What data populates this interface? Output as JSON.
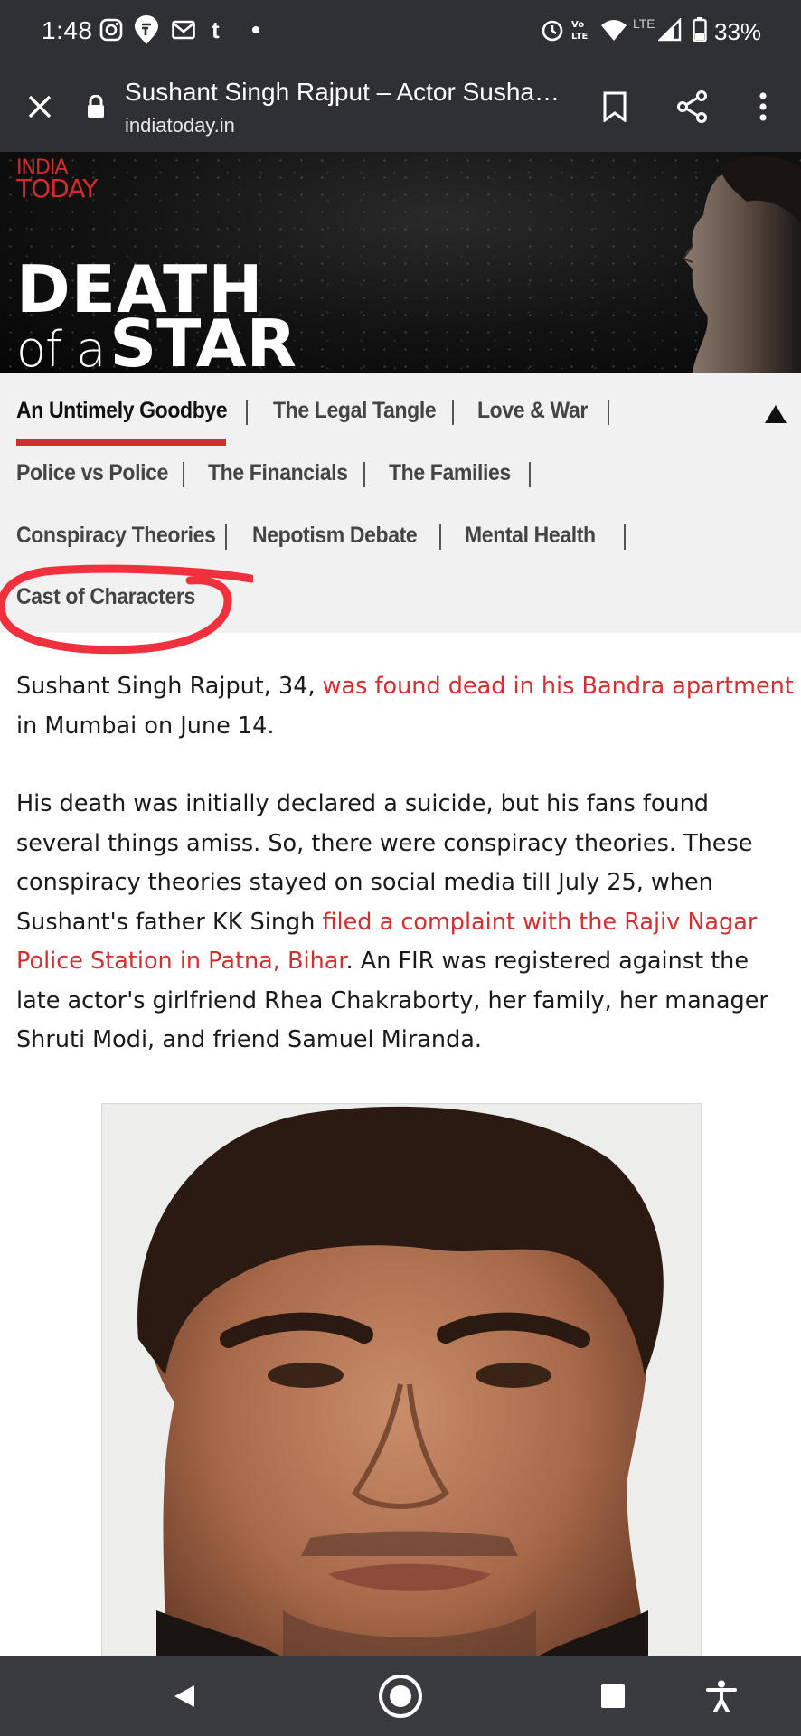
{
  "status_bar": {
    "time": "1:48",
    "battery": "33%",
    "network": "LTE",
    "left_icons": [
      "instagram-icon",
      "swiggy-icon",
      "gmail-icon",
      "tumblr-icon",
      "dot-icon"
    ],
    "right_icons": [
      "alarm-icon",
      "volte-icon",
      "wifi-icon",
      "signal-icon",
      "battery-icon"
    ]
  },
  "browser": {
    "title": "Sushant Singh Rajput – Actor Sushant Singh Rajput dead",
    "url": "indiatoday.in",
    "icons": [
      "close-icon",
      "lock-icon",
      "bookmark-icon",
      "share-icon",
      "more-icon"
    ]
  },
  "banner": {
    "logo_line1": "INDIA",
    "logo_line2": "TODAY",
    "title_line1": "DEATH",
    "title_of_a": "of a",
    "title_star": "STAR"
  },
  "section_nav": {
    "items": [
      "An Untimely Goodbye",
      "The Legal Tangle",
      "Love & War",
      "Police vs Police",
      "The Financials",
      "The Families",
      "Conspiracy Theories",
      "Nepotism Debate",
      "Mental Health",
      "Cast of Characters"
    ],
    "active": "An Untimely Goodbye",
    "accent": "#d32f2f",
    "collapse_icon": "triangle-up-icon"
  },
  "article": {
    "p1_a": "Sushant Singh Rajput, 34, ",
    "p1_link": "was found dead in his Bandra apartment",
    "p1_b": " in Mumbai on June 14.",
    "p2_a": "His death was initially declared a suicide, but his fans found several things amiss. So, there were conspiracy theories. These conspiracy theories stayed on social media till July 25, when Sushant's father KK Singh ",
    "p2_link": "filed a complaint with the Rajiv Nagar Police Station in Patna, Bihar",
    "p2_b": ". An FIR was registered against the late actor's girlfriend Rhea Chakraborty, her family, her manager Shruti Modi, and friend Samuel Miranda.",
    "link_color": "#d32f2f"
  },
  "system_nav": {
    "icons": [
      "back-icon",
      "home-icon",
      "recents-icon",
      "accessibility-icon"
    ]
  }
}
